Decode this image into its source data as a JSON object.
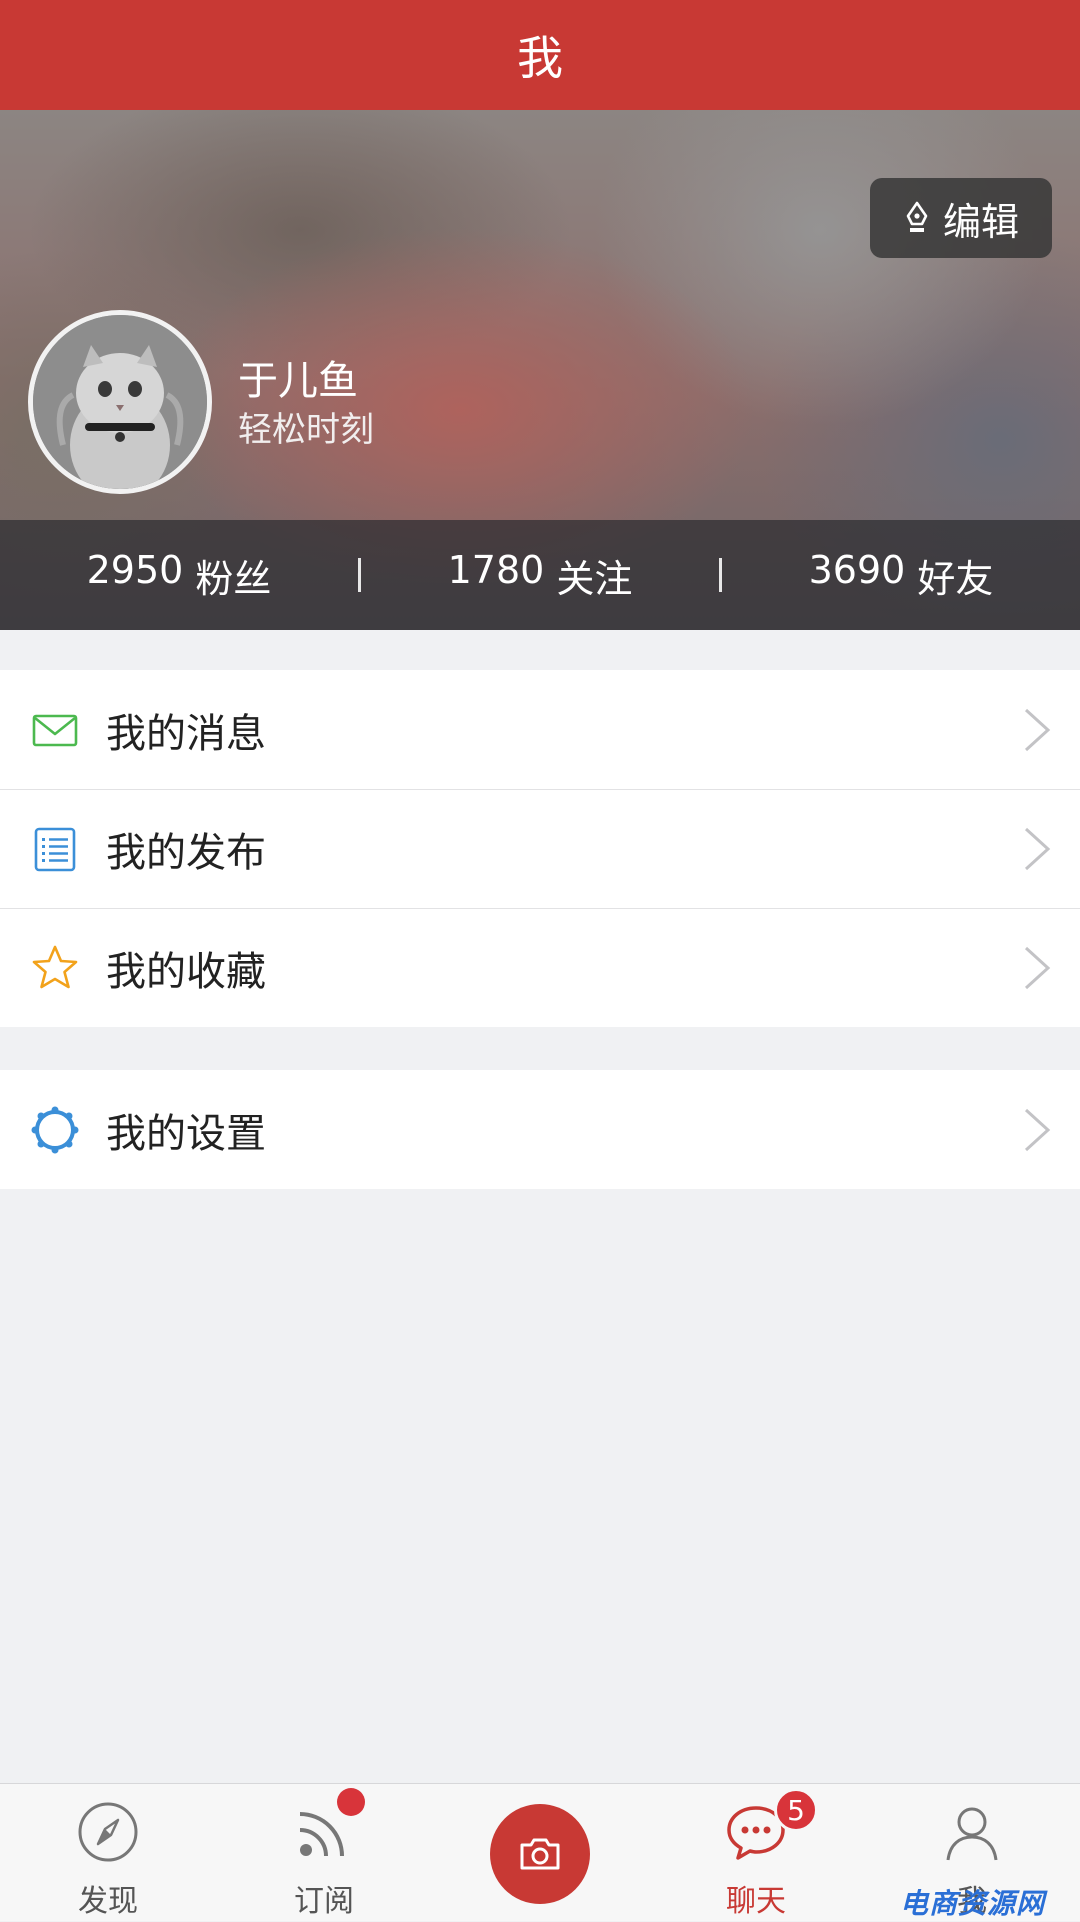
{
  "header": {
    "title": "我"
  },
  "profile": {
    "edit_label": "编辑",
    "name": "于儿鱼",
    "subtitle": "轻松时刻"
  },
  "stats": [
    {
      "value": "2950",
      "label": "粉丝"
    },
    {
      "value": "1780",
      "label": "关注"
    },
    {
      "value": "3690",
      "label": "好友"
    }
  ],
  "menu_group_1": [
    {
      "label": "我的消息",
      "icon": "mail-icon",
      "color": "#4cb94f"
    },
    {
      "label": "我的发布",
      "icon": "list-document-icon",
      "color": "#3b8fd8"
    },
    {
      "label": "我的收藏",
      "icon": "star-icon",
      "color": "#f2a21b"
    }
  ],
  "menu_group_2": [
    {
      "label": "我的设置",
      "icon": "settings-icon",
      "color": "#3b8fd8"
    }
  ],
  "tabbar": {
    "tabs": [
      {
        "label": "发现",
        "icon": "compass-icon"
      },
      {
        "label": "订阅",
        "icon": "rss-icon"
      },
      {
        "label": "",
        "icon": "camera-icon"
      },
      {
        "label": "聊天",
        "icon": "chat-bubble-icon",
        "badge": "5"
      },
      {
        "label": "我",
        "icon": "user-icon"
      }
    ],
    "active_tab": "聊天",
    "accent": "#c83934"
  },
  "watermark": "电商资源网"
}
